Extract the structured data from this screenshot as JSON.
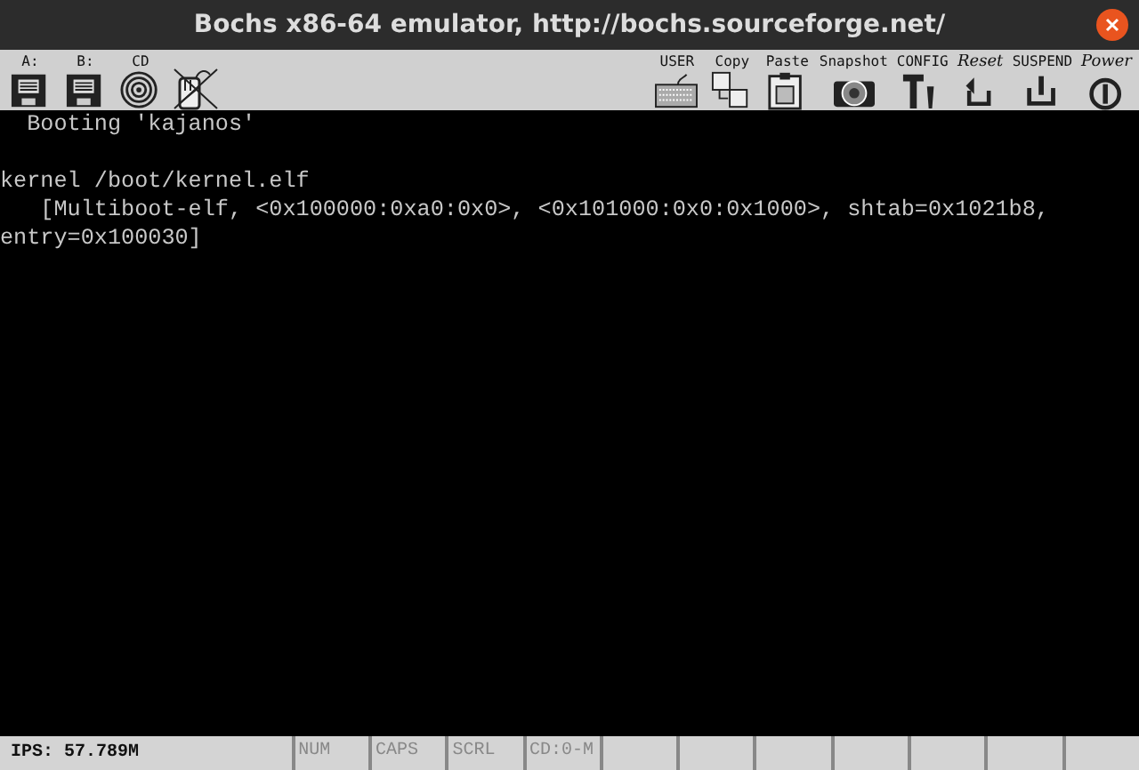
{
  "window": {
    "title": "Bochs x86-64 emulator, http://bochs.sourceforge.net/"
  },
  "toolbar_left": [
    {
      "kind": "floppy",
      "label": "A:"
    },
    {
      "kind": "floppy",
      "label": "B:"
    },
    {
      "kind": "cdrom",
      "label": "CD"
    },
    {
      "kind": "mouse",
      "captured": false
    }
  ],
  "toolbar_right": [
    {
      "kind": "keyboard",
      "label": "USER"
    },
    {
      "kind": "copy",
      "label": "Copy"
    },
    {
      "kind": "paste",
      "label": "Paste"
    },
    {
      "kind": "snapshot",
      "label": "Snapshot"
    },
    {
      "kind": "config",
      "label": "CONFIG"
    },
    {
      "kind": "reset",
      "label": "Reset"
    },
    {
      "kind": "suspend",
      "label": "SUSPEND"
    },
    {
      "kind": "power",
      "label": "Power"
    }
  ],
  "console": {
    "blocks": [
      {
        "lines": [
          "  Booting 'kajanos'"
        ]
      },
      {
        "lines": [
          "kernel /boot/kernel.elf",
          "   [Multiboot-elf, <0x100000:0xa0:0x0>, <0x101000:0x0:0x1000>, shtab=0x1021b8,",
          "entry=0x100030]"
        ]
      }
    ]
  },
  "status_bar": {
    "ips": "IPS: 57.789M",
    "indicators": [
      {
        "label": "NUM",
        "on": false
      },
      {
        "label": "CAPS",
        "on": false
      },
      {
        "label": "SCRL",
        "on": false
      },
      {
        "label": "CD:0-M",
        "on": false
      }
    ]
  }
}
